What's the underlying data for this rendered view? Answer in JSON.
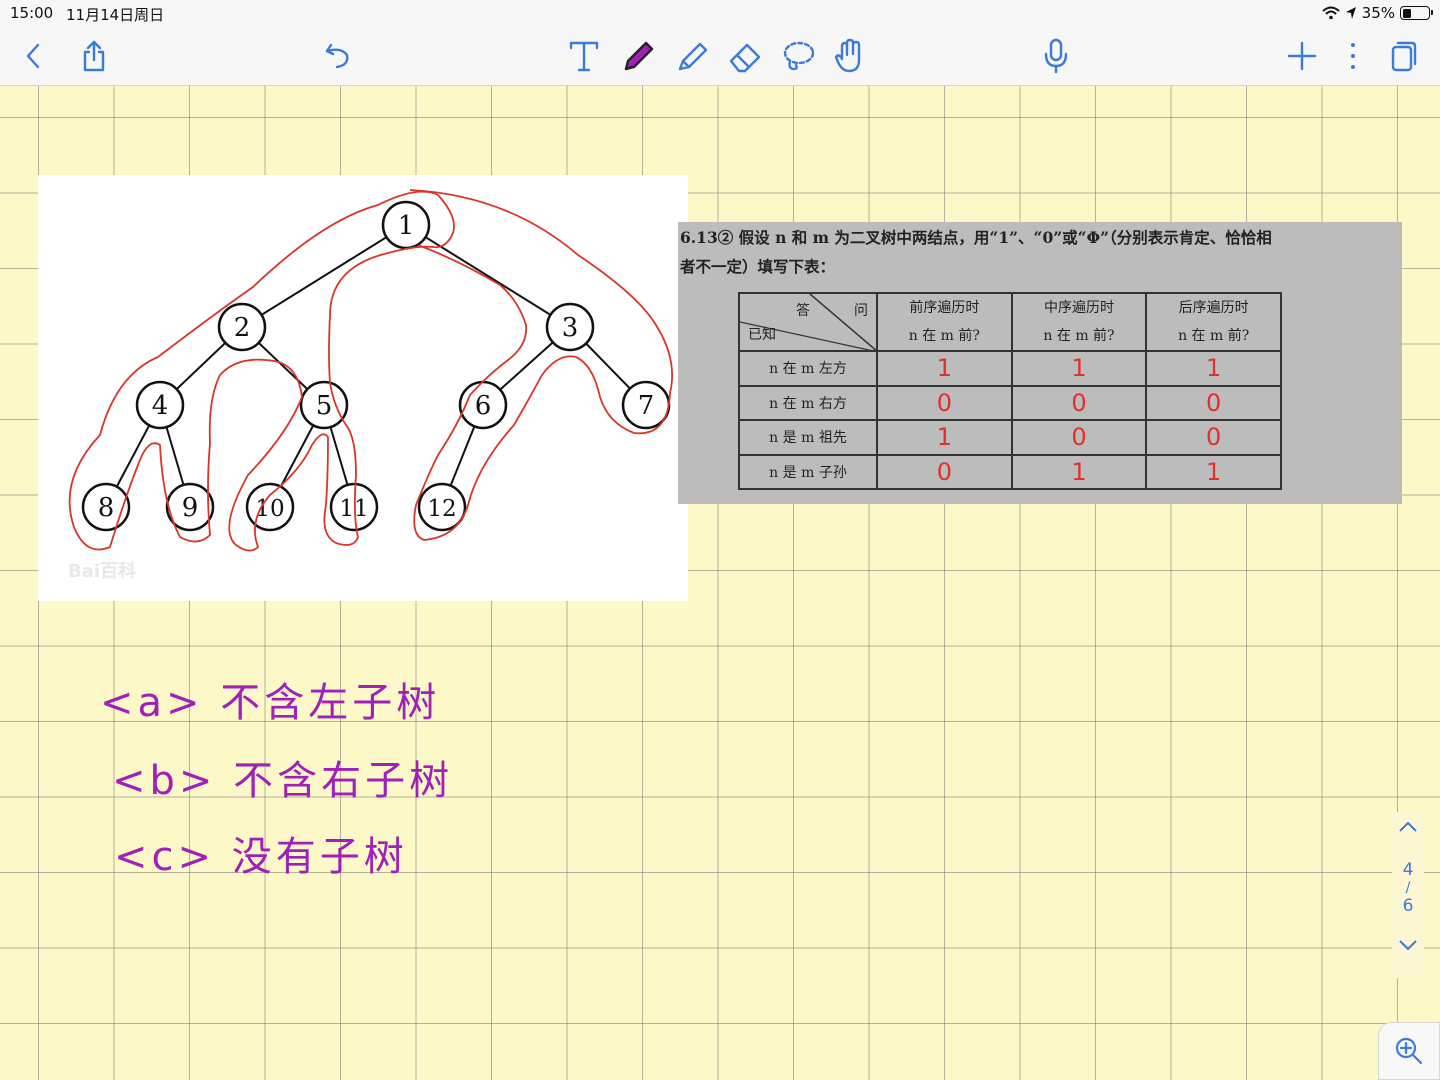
{
  "status_bar": {
    "time": "15:00",
    "date": "11月14日周日",
    "battery": "35%",
    "battery_level": 0.35
  },
  "toolbar": {
    "icons": [
      "back-icon",
      "share-icon",
      "undo-icon",
      "text-tool-icon",
      "pen-icon",
      "highlighter-icon",
      "eraser-icon",
      "lasso-icon",
      "hand-icon",
      "microphone-icon",
      "add-icon",
      "more-icon",
      "pages-icon"
    ],
    "accent": "#3b7bd8"
  },
  "tree_image": {
    "nodes": [
      "1",
      "2",
      "3",
      "4",
      "5",
      "6",
      "7",
      "8",
      "9",
      "10",
      "11",
      "12"
    ],
    "watermark": "Bai百科"
  },
  "question": {
    "number": "6.13②",
    "text_line1": "假设 n 和 m 为二叉树中两结点，用“1”、“0”或“Φ”（分别表示肯定、恰恰相",
    "text_line2": "者不一定）填写下表：",
    "corner_top": "答",
    "corner_top2": "问",
    "corner_bottom": "已知",
    "columns": [
      {
        "line1": "前序遍历时",
        "line2": "n 在 m 前?"
      },
      {
        "line1": "中序遍历时",
        "line2": "n 在 m 前?"
      },
      {
        "line1": "后序遍历时",
        "line2": "n 在 m 前?"
      }
    ],
    "rows": [
      {
        "label": "n 在 m 左方",
        "answers": [
          "1",
          "1",
          "1"
        ]
      },
      {
        "label": "n 在 m 右方",
        "answers": [
          "0",
          "0",
          "0"
        ]
      },
      {
        "label": "n 是 m 祖先",
        "answers": [
          "1",
          "0",
          "0"
        ]
      },
      {
        "label": "n 是 m 子孙",
        "answers": [
          "0",
          "1",
          "1"
        ]
      }
    ],
    "ink_color": "#e0322a"
  },
  "handwritten_notes": {
    "lines": [
      "<a> 不含左子树",
      "<b> 不含右子树",
      "<c> 没有子树"
    ],
    "ink_color": "#a020b8"
  },
  "pager": {
    "current": "4",
    "separator": "/",
    "total": "6"
  }
}
